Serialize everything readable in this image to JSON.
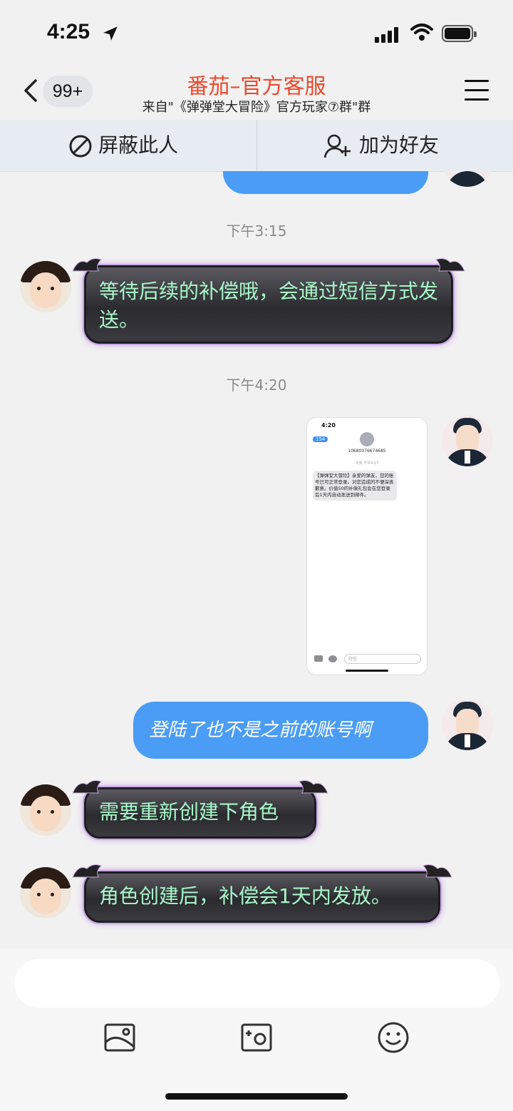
{
  "status_bar": {
    "time": "4:25"
  },
  "header": {
    "unread_count": "99+",
    "title": "番茄–官方客服",
    "subtitle": "来自\"《弹弹堂大冒险》官方玩家⑦群\"群"
  },
  "action_bar": {
    "block_label": "屏蔽此人",
    "add_friend_label": "加为好友"
  },
  "chat": {
    "timestamps": [
      "下午3:15",
      "下午4:20"
    ],
    "messages": [
      {
        "sender": "agent",
        "text": "等待后续的补偿哦，会通过短信方式发送。"
      },
      {
        "sender": "user",
        "type": "image",
        "screenshot": {
          "time": "4:20",
          "back_count": "154",
          "number": "10680076674685",
          "date_line": "今天 下午4:17",
          "sms": "【弹弹堂大冒险】亲爱的弹友，您的账号已可正常登录。对您造成的不便深表歉意。价值50的补偿礼包会在您登录后1天内自动发送到邮件。",
          "input_placeholder": "短信"
        }
      },
      {
        "sender": "user",
        "text": "登陆了也不是之前的账号啊"
      },
      {
        "sender": "agent",
        "text": "需要重新创建下角色"
      },
      {
        "sender": "agent",
        "text": "角色创建后，补偿会1天内发放。"
      }
    ]
  },
  "colors": {
    "title": "#ea4a2e",
    "user_bubble": "#4a9cf5",
    "agent_text": "#a8f7c8"
  }
}
